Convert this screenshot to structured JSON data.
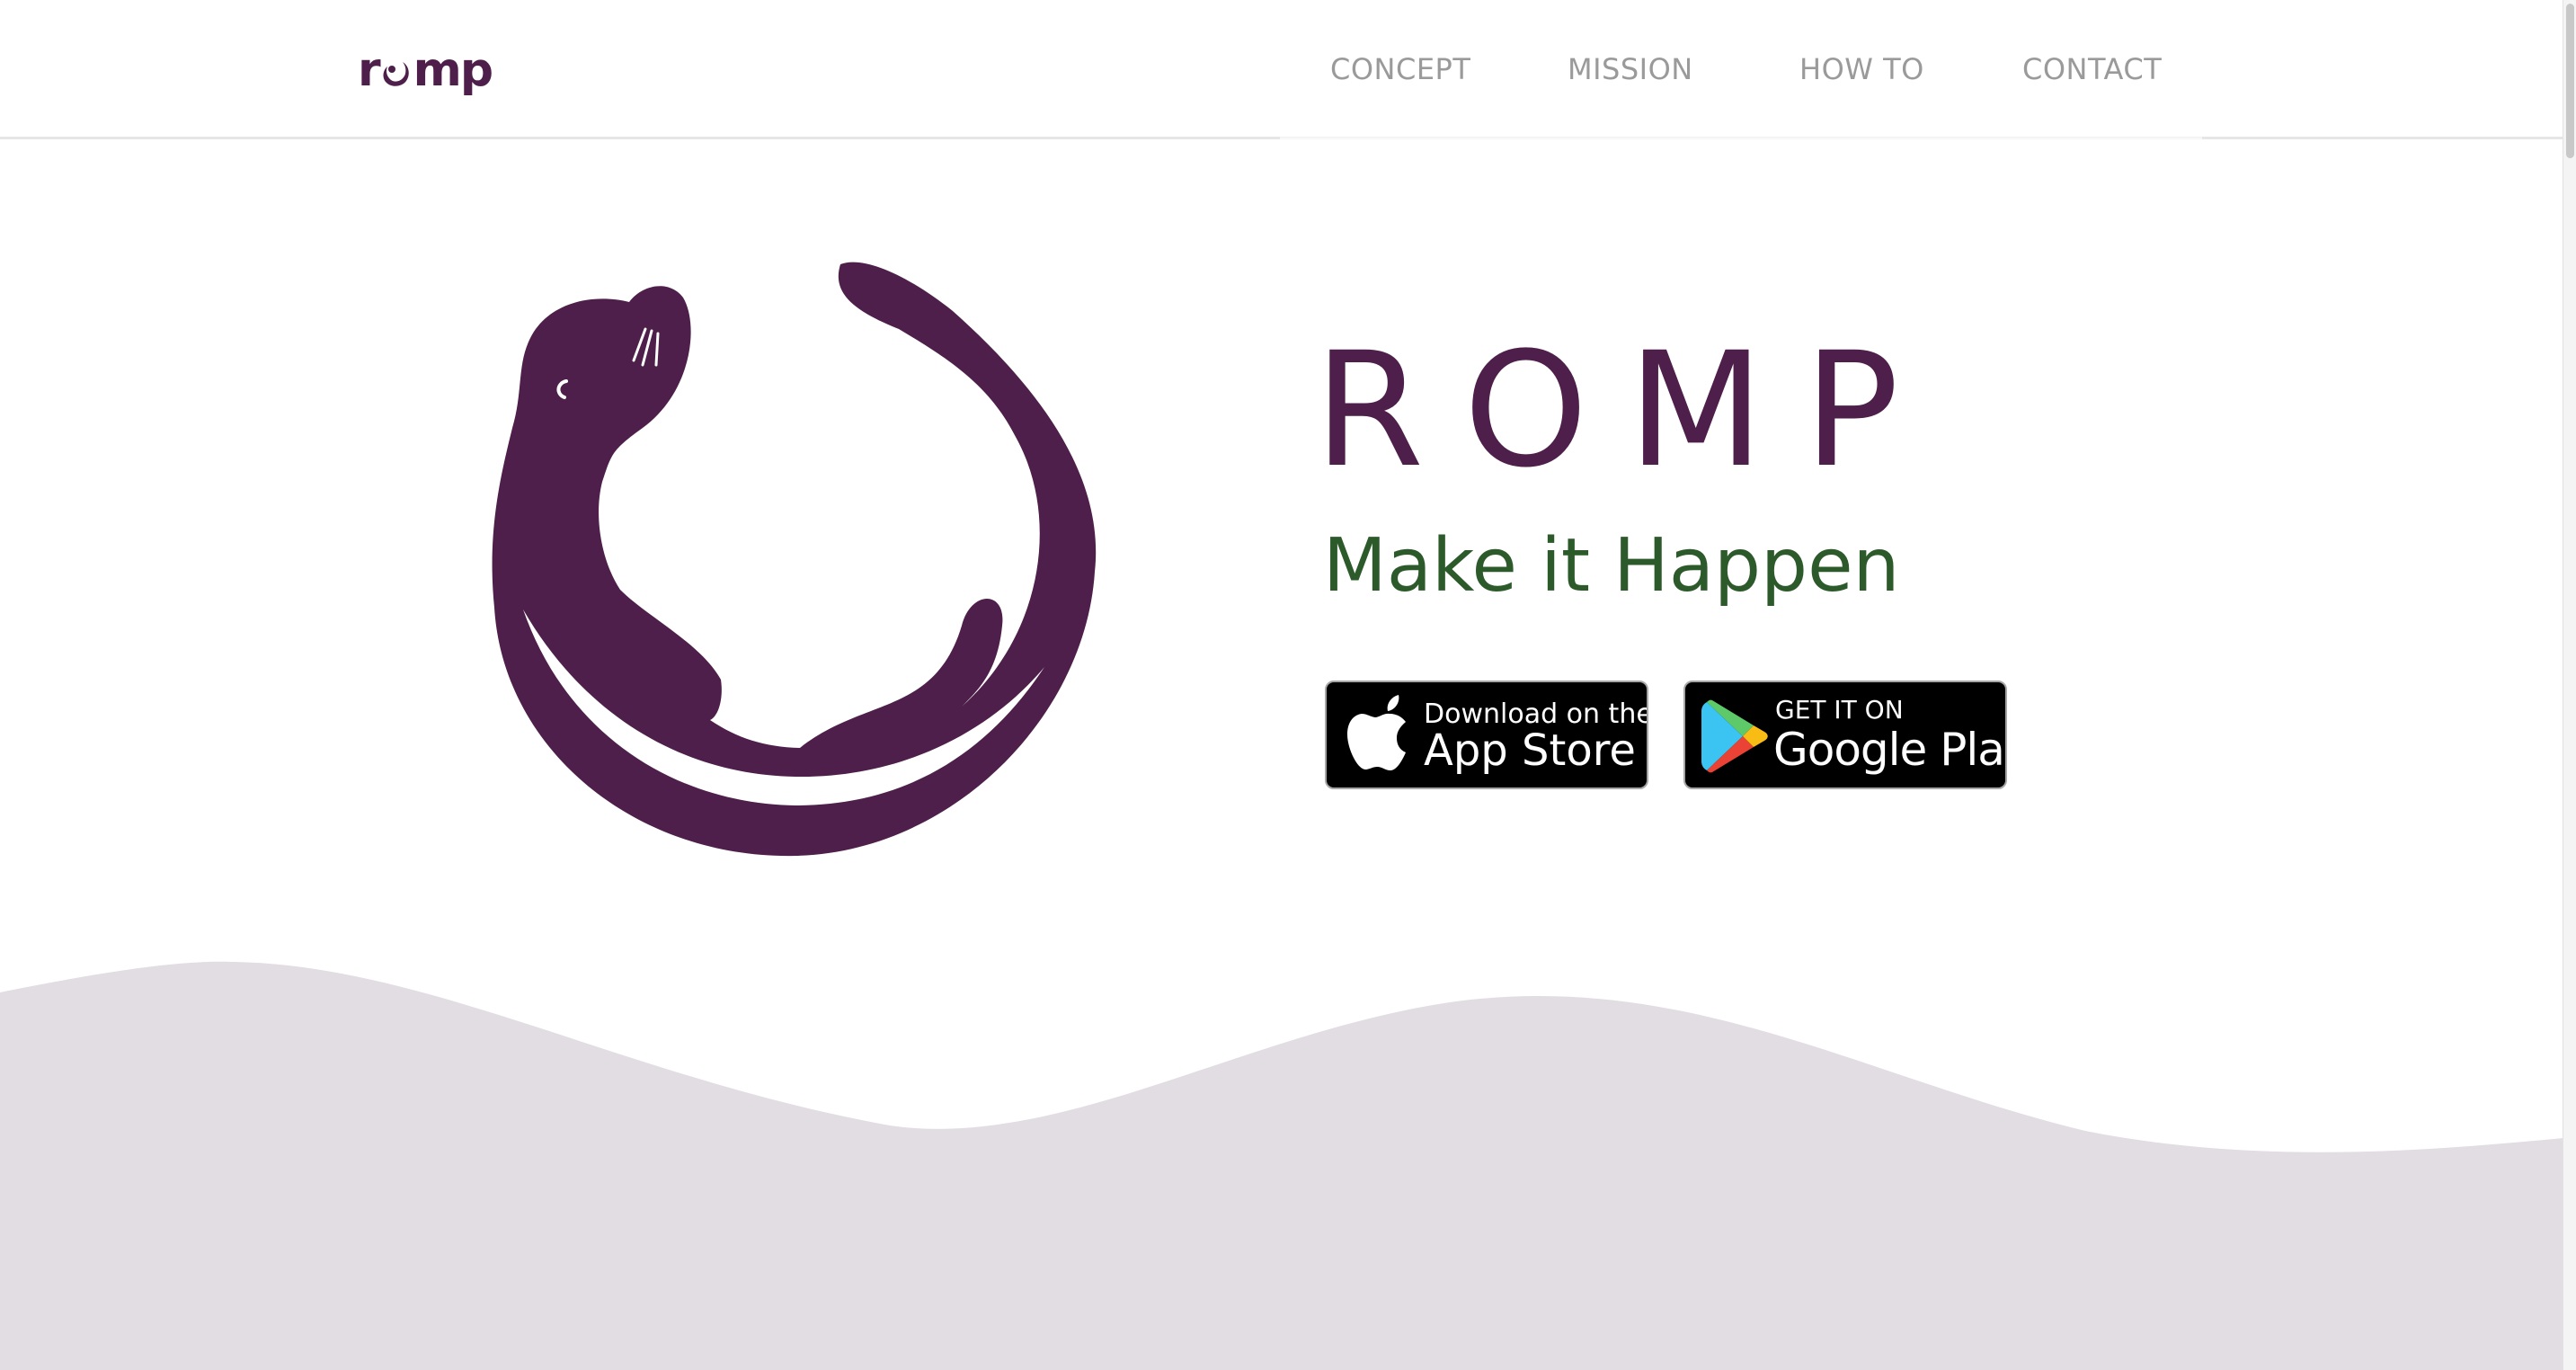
{
  "brand": {
    "logo_text_left": "r",
    "logo_text_right": "mp"
  },
  "nav": {
    "items": [
      {
        "label": "CONCEPT"
      },
      {
        "label": "MISSION"
      },
      {
        "label": "HOW TO"
      },
      {
        "label": "CONTACT"
      }
    ]
  },
  "hero": {
    "title": "ROMP",
    "subtitle": "Make it Happen"
  },
  "stores": {
    "apple": {
      "line1": "Download on the",
      "line2": "App Store"
    },
    "google": {
      "line1": "GET IT ON",
      "line2": "Google Play"
    }
  },
  "colors": {
    "brand_purple": "#4e1f4a",
    "subtitle_green": "#2d5a2b",
    "nav_gray": "#9a9a9a",
    "wave_lavender": "#e2dce3"
  },
  "icons": {
    "apple": "apple-logo-icon",
    "google_play": "google-play-icon",
    "otter": "otter-logo-icon"
  }
}
